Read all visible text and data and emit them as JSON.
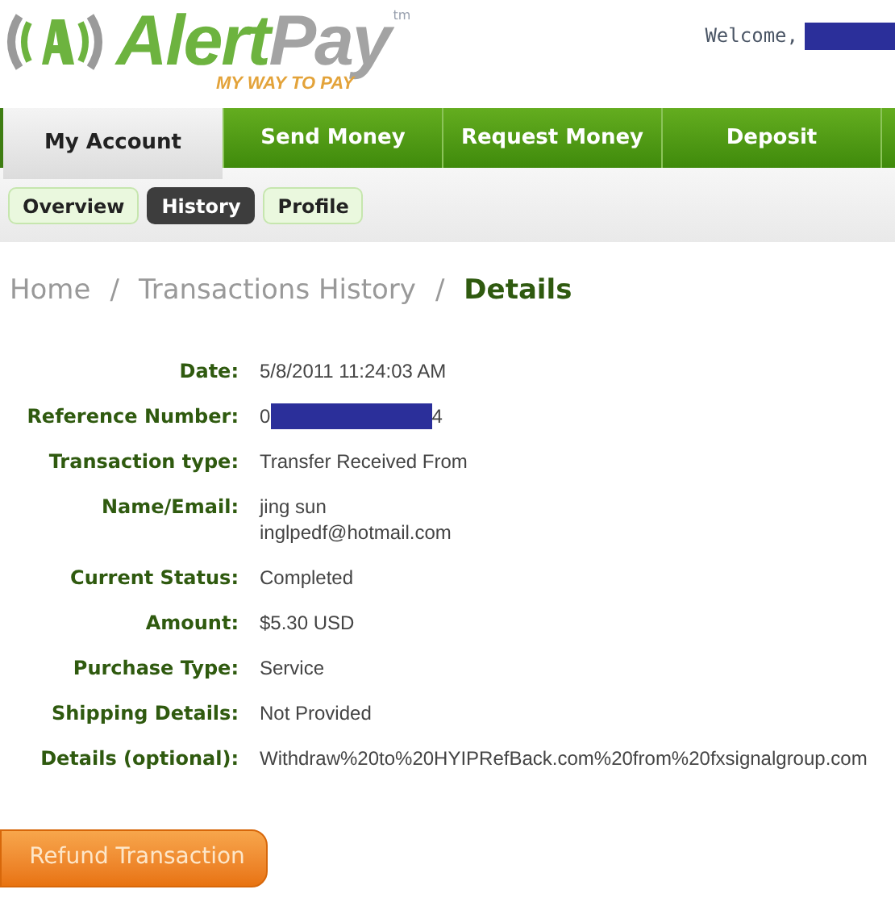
{
  "logo": {
    "name_part1": "Alert",
    "name_part2": "Pay",
    "trademark": "tm",
    "tagline": "MY WAY TO PAY"
  },
  "welcome": {
    "label": "Welcome,",
    "name_redacted": true
  },
  "nav_tabs": [
    {
      "label": "My Account",
      "selected": true
    },
    {
      "label": "Send Money",
      "selected": false
    },
    {
      "label": "Request Money",
      "selected": false
    },
    {
      "label": "Deposit",
      "selected": false
    }
  ],
  "sub_tabs": [
    {
      "label": "Overview",
      "selected": false
    },
    {
      "label": "History",
      "selected": true
    },
    {
      "label": "Profile",
      "selected": false
    }
  ],
  "breadcrumb": [
    {
      "label": "Home",
      "current": false
    },
    {
      "separator": "/",
      "label": "Transactions History",
      "current": false
    },
    {
      "separator": "/",
      "label": "Details",
      "current": true
    }
  ],
  "details": [
    {
      "label": "Date:",
      "lines": [
        "5/8/2011 11:24:03 AM"
      ]
    },
    {
      "label": "Reference Number:",
      "lines": [
        "0"
      ],
      "redacted": true,
      "value_after_redaction": "4"
    },
    {
      "label": "Transaction type:",
      "lines": [
        "Transfer Received From"
      ]
    },
    {
      "label": "Name/Email:",
      "lines": [
        "jing sun",
        "inglpedf@hotmail.com"
      ]
    },
    {
      "label": "Current Status:",
      "lines": [
        "Completed"
      ]
    },
    {
      "label": "Amount:",
      "lines": [
        "$5.30 USD"
      ]
    },
    {
      "label": "Purchase Type:",
      "lines": [
        "Service"
      ]
    },
    {
      "label": "Shipping Details:",
      "lines": [
        "Not Provided"
      ]
    },
    {
      "label": "Details (optional):",
      "lines": [
        "Withdraw%20to%20HYIPRefBack.com%20from%20fxsignalgroup.com"
      ]
    }
  ],
  "refund_button": "Refund Transaction"
}
